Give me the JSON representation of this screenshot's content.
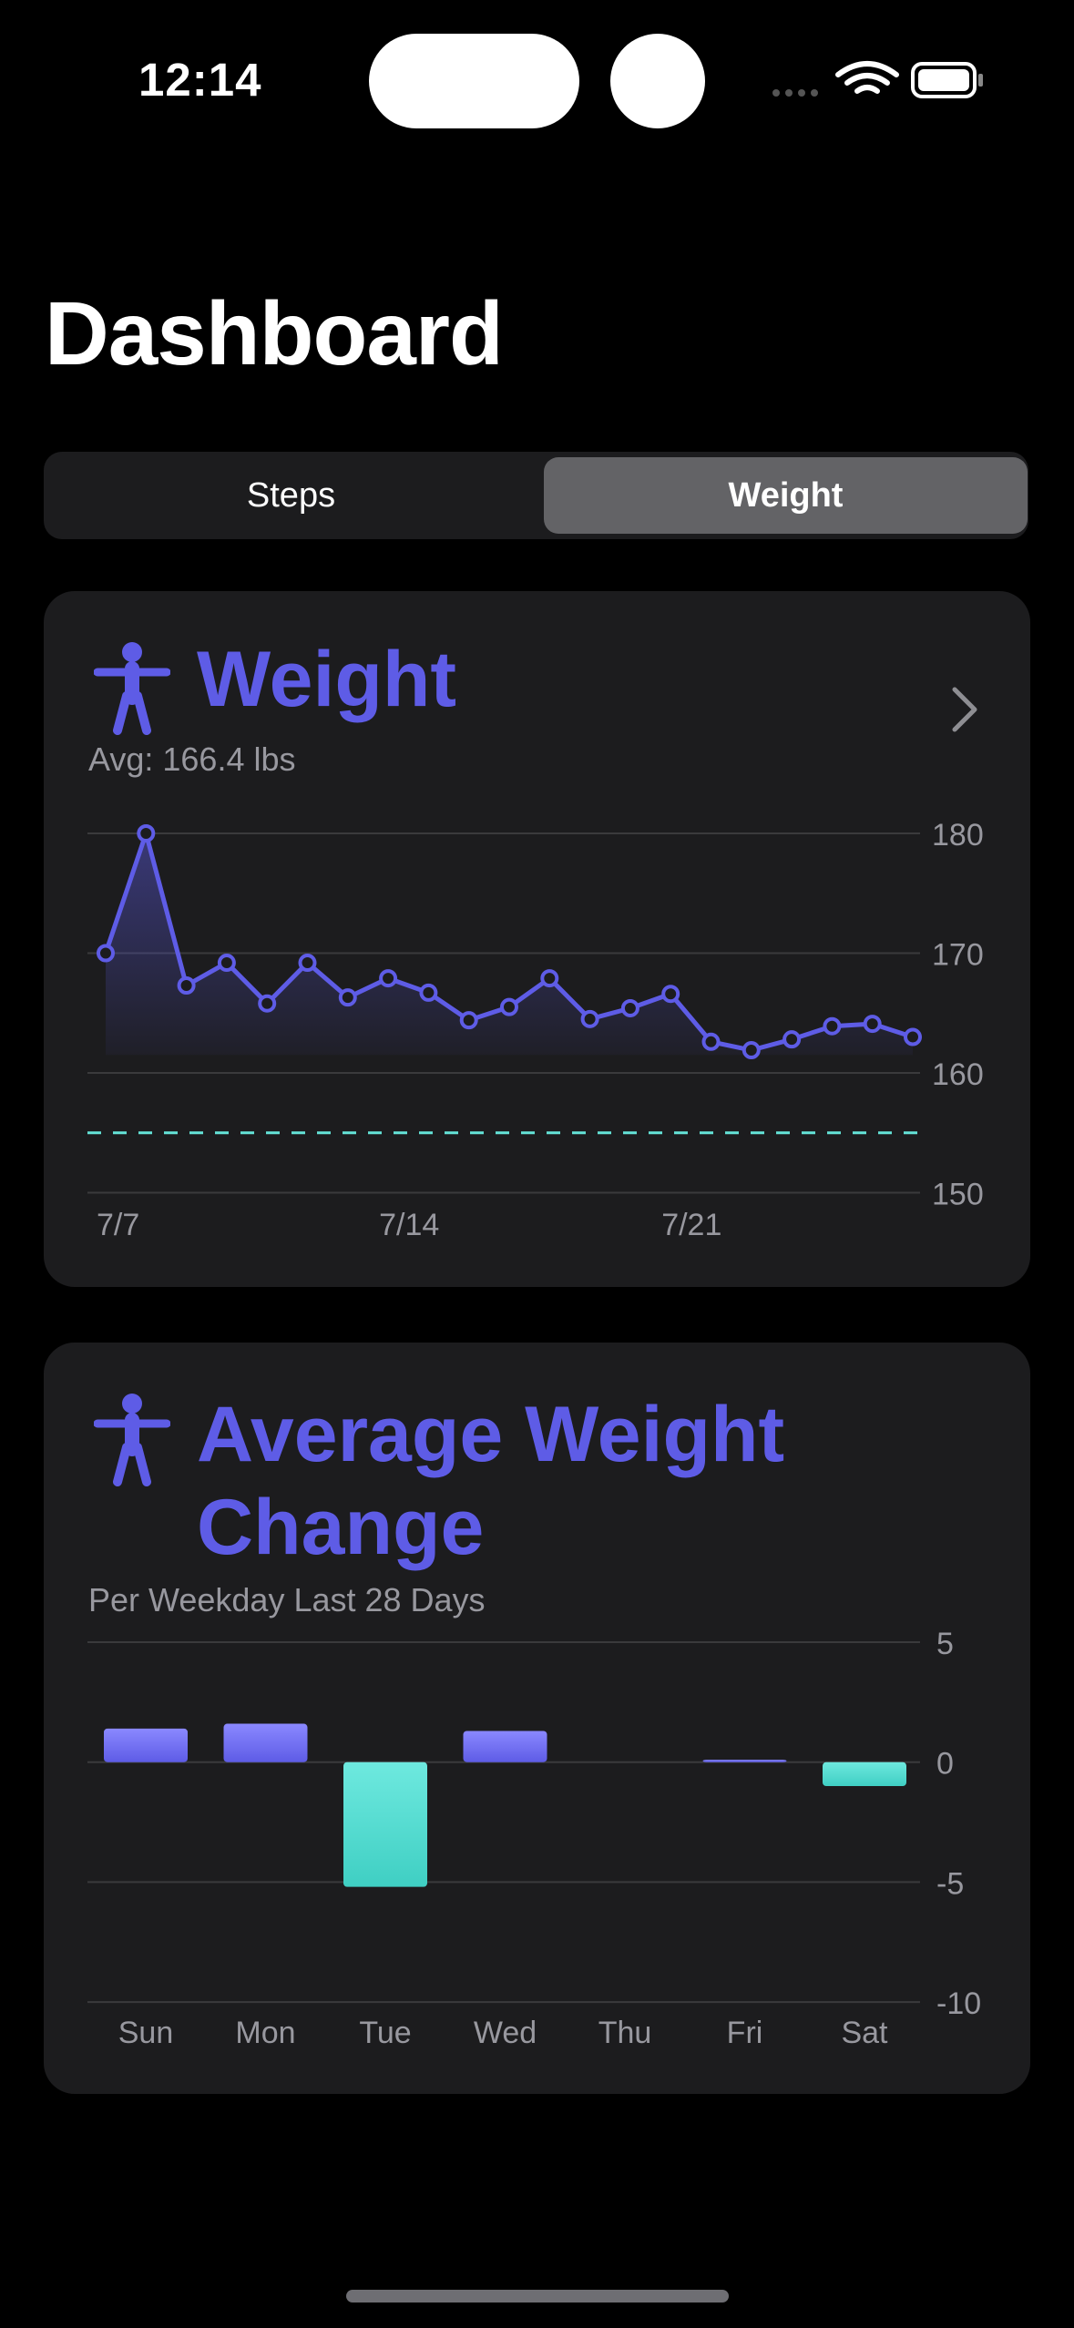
{
  "status_bar": {
    "time": "12:14"
  },
  "page": {
    "title": "Dashboard"
  },
  "segmented_control": {
    "options": [
      "Steps",
      "Weight"
    ],
    "selected": "Weight"
  },
  "colors": {
    "accent": "#5e5ce6",
    "teal": "#64e3d8",
    "card": "#1c1c1e",
    "gridline": "#3a3a3c"
  },
  "weight_card": {
    "icon": "figure-icon",
    "title": "Weight",
    "subtitle": "Avg: 166.4 lbs"
  },
  "change_card": {
    "icon": "figure-icon",
    "title_line1": "Average Weight",
    "title_line2": "Change",
    "subtitle": "Per Weekday Last 28 Days"
  },
  "chart_data": [
    {
      "type": "line",
      "x": [
        "7/7",
        "7/8",
        "7/9",
        "7/10",
        "7/11",
        "7/12",
        "7/13",
        "7/14",
        "7/15",
        "7/16",
        "7/17",
        "7/18",
        "7/19",
        "7/20",
        "7/21",
        "7/22",
        "7/23",
        "7/24",
        "7/25",
        "7/26",
        "7/27",
        "7/28"
      ],
      "series": [
        {
          "values": [
            170,
            180,
            167.3,
            169.2,
            165.8,
            169.2,
            166.3,
            167.9,
            166.7,
            164.4,
            165.5,
            167.9,
            164.5,
            165.4,
            166.6,
            162.6,
            161.9,
            162.8,
            163.9,
            164.1,
            163
          ]
        }
      ],
      "x_tick_labels": [
        "7/7",
        "7/14",
        "7/21"
      ],
      "y_ticks": [
        150,
        160,
        170,
        180
      ],
      "ylim": [
        150,
        180
      ],
      "goal_line": 155,
      "grid": true
    },
    {
      "type": "bar",
      "categories": [
        "Sun",
        "Mon",
        "Tue",
        "Wed",
        "Thu",
        "Fri",
        "Sat"
      ],
      "values": [
        1.4,
        1.6,
        -5.2,
        1.3,
        0,
        0.1,
        -1.0
      ],
      "y_ticks": [
        5,
        0,
        -5,
        -10
      ],
      "ylim": [
        -10,
        5
      ],
      "grid": true
    }
  ]
}
